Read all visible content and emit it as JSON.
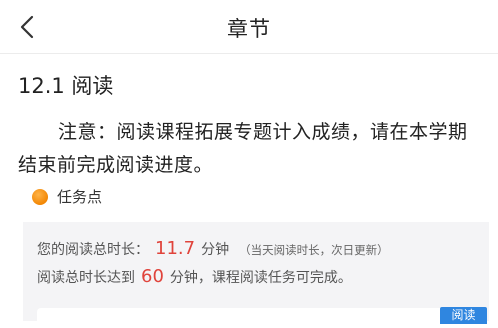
{
  "header": {
    "title": "章节"
  },
  "chapter": {
    "title": "12.1 阅读"
  },
  "notice": {
    "text": "注意：阅读课程拓展专题计入成绩，请在本学期结束前完成阅读进度。"
  },
  "task": {
    "label": "任务点"
  },
  "reading": {
    "total_label": "您的阅读总时长：",
    "total_value": "11.7",
    "total_unit": "分钟",
    "total_hint": "（当天阅读时长，次日更新）",
    "goal_prefix": "阅读总时长达到",
    "goal_value": "60",
    "goal_suffix": "分钟，课程阅读任务可完成。"
  },
  "read_button": "阅读",
  "colors": {
    "accent_red": "#e0433b",
    "task_orange": "#f28705",
    "button_blue": "#2f86e0"
  }
}
